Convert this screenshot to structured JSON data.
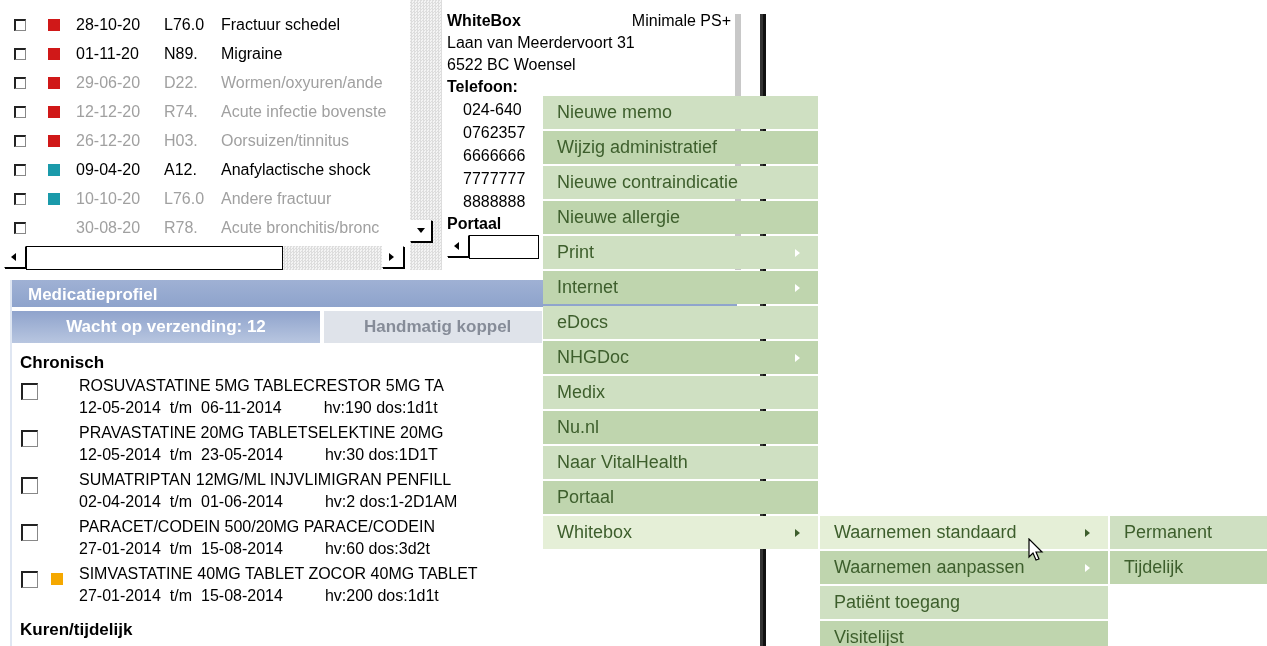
{
  "episodes": [
    {
      "checked": false,
      "color": "#d01818",
      "date": "28-10-20",
      "code": "L76.0",
      "description": "Fractuur schedel",
      "active": true
    },
    {
      "checked": false,
      "color": "#d01818",
      "date": "01-11-20",
      "code": "N89.",
      "description": "Migraine",
      "active": true
    },
    {
      "checked": false,
      "color": "#d01818",
      "date": "29-06-20",
      "code": "D22.",
      "description": "Wormen/oxyuren/ande",
      "active": false
    },
    {
      "checked": false,
      "color": "#d01818",
      "date": "12-12-20",
      "code": "R74.",
      "description": "Acute infectie bovenste",
      "active": false
    },
    {
      "checked": false,
      "color": "#d01818",
      "date": "26-12-20",
      "code": "H03.",
      "description": "Oorsuizen/tinnitus",
      "active": false
    },
    {
      "checked": false,
      "color": "#1a9aaa",
      "date": "09-04-20",
      "code": "A12.",
      "description": "Anafylactische shock",
      "active": true
    },
    {
      "checked": false,
      "color": "#1a9aaa",
      "date": "10-10-20",
      "code": "L76.0",
      "description": "Andere fractuur",
      "active": false
    },
    {
      "checked": false,
      "date": "30-08-20",
      "code": "R78.",
      "description": "Acute bronchitis/bronc",
      "active": false
    }
  ],
  "contact": {
    "name": "WhiteBox",
    "plan": "Minimale PS+",
    "address": "Laan van Meerdervoort 31",
    "city": "6522 BC Woensel",
    "phone_label": "Telefoon:",
    "phones": [
      "024-640",
      "0762357",
      "6666666",
      "7777777",
      "8888888"
    ],
    "portal_label": "Portaal"
  },
  "medication": {
    "title": "Medicatieprofiel",
    "tabs": [
      {
        "label": "Wacht op verzending: 12",
        "selected": true
      },
      {
        "label": "Handmatig koppel",
        "selected": false
      }
    ],
    "groups": [
      {
        "title": "Chronisch",
        "items": [
          {
            "checked": false,
            "name": "ROSUVASTATINE 5MG TABLECRESTOR 5MG TA",
            "start": "12-05-2014",
            "until": "t/m",
            "end": "06-11-2014",
            "details": "hv:190 dos:1d1t"
          },
          {
            "checked": false,
            "name": "PRAVASTATINE 20MG TABLETSELEKTINE 20MG",
            "start": "12-05-2014",
            "until": "t/m",
            "end": "23-05-2014",
            "details": "hv:30 dos:1D1T"
          },
          {
            "checked": false,
            "name": "SUMATRIPTAN 12MG/ML INJVLIMIGRAN PENFILL",
            "start": "02-04-2014",
            "until": "t/m",
            "end": "01-06-2014",
            "details": "hv:2 dos:1-2D1AM"
          },
          {
            "checked": false,
            "name": "PARACET/CODEIN 500/20MG PARACE/CODEIN",
            "start": "27-01-2014",
            "until": "t/m",
            "end": "15-08-2014",
            "details": "hv:60 dos:3d2t"
          },
          {
            "checked": false,
            "color": "#f5a800",
            "name": "SIMVASTATINE 40MG TABLET ZOCOR 40MG TABLET",
            "start": "27-01-2014",
            "until": "t/m",
            "end": "15-08-2014",
            "details": "hv:200 dos:1d1t"
          }
        ]
      },
      {
        "title": "Kuren/tijdelijk"
      }
    ]
  },
  "context_menu": {
    "items": [
      {
        "label": "Nieuwe memo",
        "submenu": false,
        "selected": false
      },
      {
        "label": "Wijzig administratief",
        "submenu": false,
        "selected": false
      },
      {
        "label": "Nieuwe contraindicatie",
        "submenu": false,
        "selected": false
      },
      {
        "label": "Nieuwe allergie",
        "submenu": false,
        "selected": false
      },
      {
        "label": "Print",
        "submenu": true,
        "selected": false
      },
      {
        "label": "Internet",
        "submenu": true,
        "selected": false
      },
      {
        "label": "eDocs",
        "submenu": false,
        "selected": false
      },
      {
        "label": "NHGDoc",
        "submenu": true,
        "selected": false
      },
      {
        "label": "Medix",
        "submenu": false,
        "selected": false
      },
      {
        "label": "Nu.nl",
        "submenu": false,
        "selected": false
      },
      {
        "label": "Naar VitalHealth",
        "submenu": false,
        "selected": false
      },
      {
        "label": "Portaal",
        "submenu": false,
        "selected": false
      },
      {
        "label": "Whitebox",
        "submenu": true,
        "selected": true
      }
    ],
    "submenu": [
      {
        "label": "Waarnemen standaard",
        "submenu": true,
        "selected": true
      },
      {
        "label": "Waarnemen aanpassen",
        "submenu": true,
        "selected": false
      },
      {
        "label": "Patiënt toegang",
        "submenu": false,
        "selected": false
      },
      {
        "label": "Visitelijst",
        "submenu": false,
        "selected": false
      }
    ],
    "submenu_2": [
      {
        "label": "Permanent",
        "submenu": false,
        "selected": false
      },
      {
        "label": "Tijdelijk",
        "submenu": false,
        "selected": false
      }
    ]
  }
}
